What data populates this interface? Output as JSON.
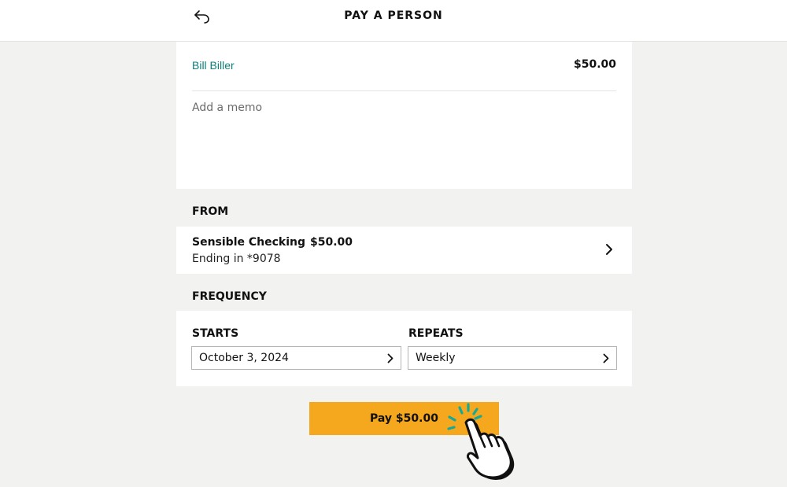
{
  "header": {
    "title": "PAY A PERSON",
    "back_icon": "undo-arrow-icon"
  },
  "payee": {
    "name": "Bill Biller",
    "amount": "$50.00",
    "name_color": "#0f7f7a"
  },
  "memo": {
    "placeholder": "Add a memo",
    "value": ""
  },
  "from": {
    "label": "FROM",
    "account_name": "Sensible Checking",
    "account_balance": "$50.00",
    "account_ending": "Ending in *9078",
    "chevron_icon": "chevron-right-icon"
  },
  "frequency": {
    "label": "FREQUENCY",
    "starts_label": "STARTS",
    "starts_value": "October 3, 2024",
    "repeats_label": "REPEATS",
    "repeats_value": "Weekly"
  },
  "pay_button": {
    "label": "Pay $50.00",
    "color": "#f5a71d"
  },
  "cursor": {
    "icon": "pointing-hand-click-icon",
    "accent": "#14a99a"
  }
}
